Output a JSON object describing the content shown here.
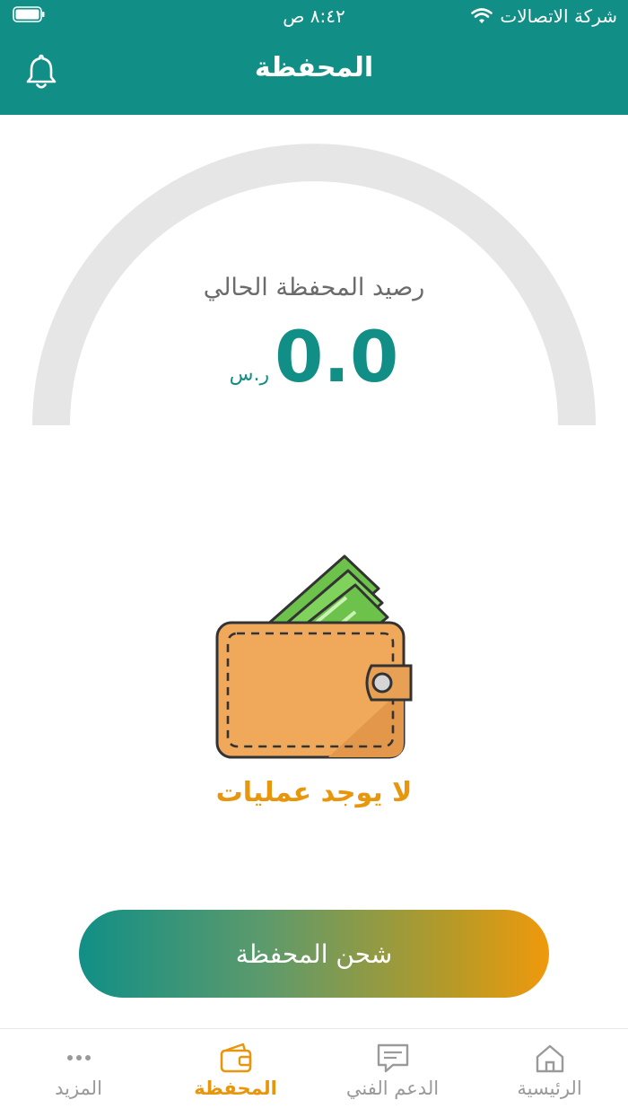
{
  "status_bar": {
    "carrier": "شركة الاتصالات",
    "time": "٨:٤٢ ص"
  },
  "header": {
    "title": "المحفظة"
  },
  "wallet": {
    "balance_label": "رصيد المحفظة الحالي",
    "balance_value": "0.0",
    "currency": "ر.س",
    "empty_message": "لا يوجد عمليات",
    "charge_button": "شحن المحفظة"
  },
  "tabbar": {
    "tabs": [
      {
        "label": "الرئيسية",
        "icon": "home-icon"
      },
      {
        "label": "الدعم الفني",
        "icon": "chat-icon"
      },
      {
        "label": "المحفظة",
        "icon": "wallet-icon"
      },
      {
        "label": "المزيد",
        "icon": "more-icon"
      }
    ],
    "active_tab": "المحفظة"
  },
  "colors": {
    "primary": "#118f86",
    "accent": "#e8960c",
    "gauge_track": "#e6e6e6"
  }
}
